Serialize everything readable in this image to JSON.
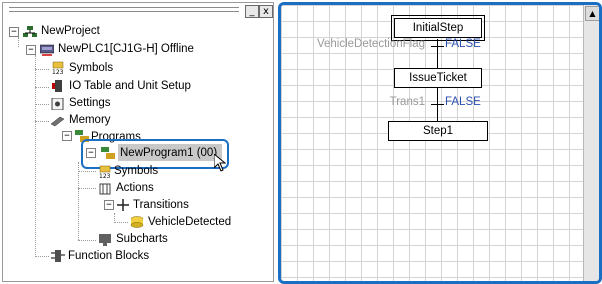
{
  "tree": {
    "window_buttons": [
      "_",
      "x"
    ],
    "items": {
      "project": "NewProject",
      "plc": "NewPLC1[CJ1G-H] Offline",
      "symbols": "Symbols",
      "io_table": "IO Table and Unit Setup",
      "settings": "Settings",
      "memory": "Memory",
      "programs": "Programs",
      "program": "NewProgram1 (00)",
      "prog_symbols": "Symbols",
      "actions": "Actions",
      "transitions": "Transitions",
      "vehicle_detected": "VehicleDetected",
      "subcharts": "Subcharts",
      "function_blocks": "Function Blocks"
    }
  },
  "diagram": {
    "initial_step": "InitialStep",
    "transition1_condition": "VehicleDetectionFlag",
    "transition1_value": "FALSE",
    "step2": "IssueTicket",
    "transition2_condition": "Trans1",
    "transition2_value": "FALSE",
    "step3": "Step1",
    "scroll_up": "▲"
  },
  "colors": {
    "highlight_border": "#1a6fc4",
    "false_text": "#2a4fb0"
  }
}
